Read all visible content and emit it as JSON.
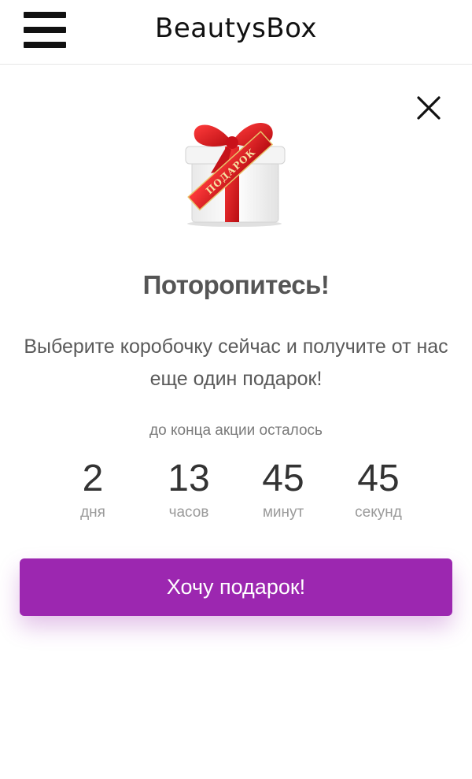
{
  "header": {
    "brand": "BeautysBox"
  },
  "icons": {
    "menu": "hamburger-menu-icon",
    "close": "close-icon",
    "gift": "gift-box-icon"
  },
  "popup": {
    "gift_ribbon_text": "ПОДАРОК",
    "title": "Поторопитесь!",
    "subtitle": "Выберите коробочку сейчас и получите от нас еще один подарок!",
    "remaining_label": "до конца акции осталось",
    "countdown": [
      {
        "value": "2",
        "unit": "дня"
      },
      {
        "value": "13",
        "unit": "часов"
      },
      {
        "value": "45",
        "unit": "минут"
      },
      {
        "value": "45",
        "unit": "секунд"
      }
    ],
    "cta_label": "Хочу подарок!"
  },
  "colors": {
    "accent": "#9c27b0",
    "ribbon": "#d8141b"
  }
}
